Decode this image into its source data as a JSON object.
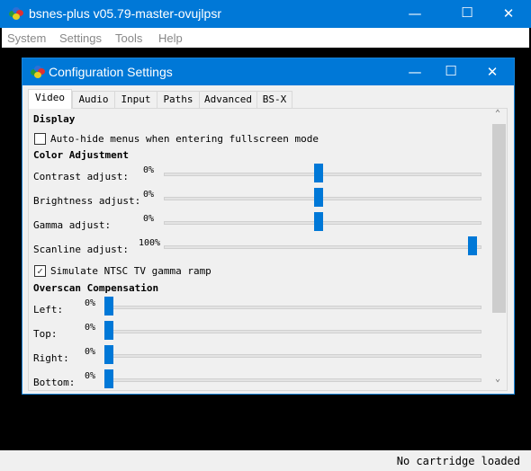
{
  "window": {
    "title": "bsnes-plus v05.79-master-ovujlpsr",
    "minimize": "—",
    "maximize": "☐",
    "close": "✕"
  },
  "menu": [
    "System",
    "Settings",
    "Tools",
    "Help"
  ],
  "status": "No cartridge loaded",
  "dialog": {
    "title": "Configuration Settings",
    "minimize": "—",
    "maximize": "☐",
    "close": "✕",
    "tabs": [
      "Video",
      "Audio",
      "Input",
      "Paths",
      "Advanced",
      "BS-X"
    ],
    "active_tab": "Video",
    "display": {
      "heading": "Display",
      "autohide": {
        "label": "Auto-hide menus when entering fullscreen mode",
        "checked": false
      }
    },
    "color": {
      "heading": "Color Adjustment",
      "sliders": [
        {
          "label": "Contrast adjust:",
          "value": "0%",
          "position": 0.5
        },
        {
          "label": "Brightness adjust:",
          "value": "0%",
          "position": 0.5
        },
        {
          "label": "Gamma adjust:",
          "value": "0%",
          "position": 0.5
        },
        {
          "label": "Scanline adjust:",
          "value": "100%",
          "position": 1.0
        }
      ]
    },
    "ntsc": {
      "label": "Simulate NTSC TV gamma ramp",
      "checked": true
    },
    "overscan": {
      "heading": "Overscan Compensation",
      "sliders": [
        {
          "label": "Left:",
          "value": "0%",
          "position": 0
        },
        {
          "label": "Top:",
          "value": "0%",
          "position": 0
        },
        {
          "label": "Right:",
          "value": "0%",
          "position": 0
        },
        {
          "label": "Bottom:",
          "value": "0%",
          "position": 0
        }
      ]
    },
    "scroll_up": "⌃",
    "scroll_down": "⌄"
  },
  "colors": {
    "accent": "#0078d7"
  }
}
